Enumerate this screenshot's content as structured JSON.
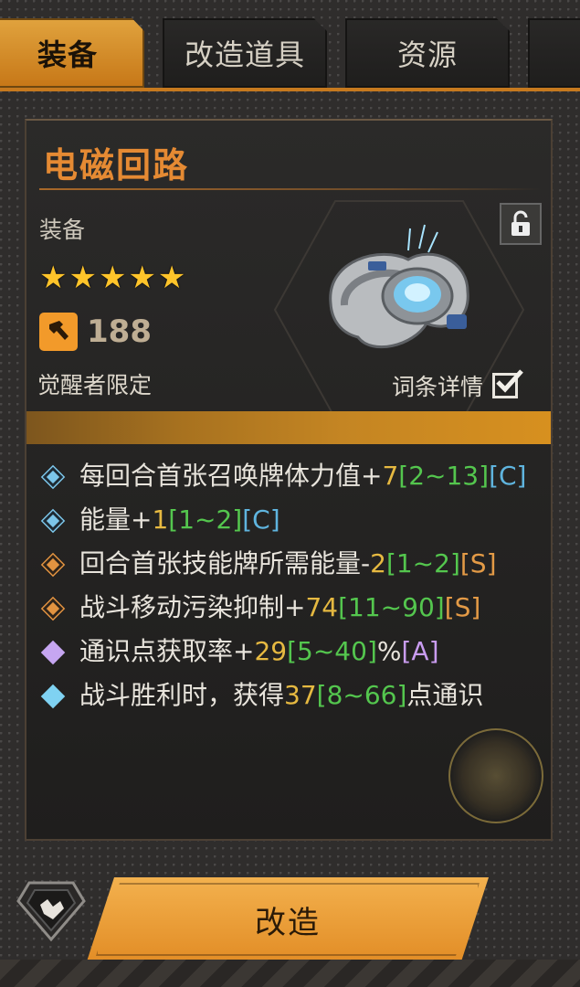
{
  "tabs": [
    {
      "label": "装备",
      "active": true
    },
    {
      "label": "改造道具",
      "active": false
    },
    {
      "label": "资源",
      "active": false
    },
    {
      "label": "",
      "active": false
    }
  ],
  "item": {
    "name": "电磁回路",
    "category": "装备",
    "rarity_stars": 5,
    "stars": "★★★★★",
    "power": "188",
    "restriction": "觉醒者限定",
    "detail_label": "词条详情",
    "detail_checked": true
  },
  "stats": [
    {
      "text": "每回合首张召唤牌体力值+",
      "value": "7",
      "range": "[2~13]",
      "grade": "[C]",
      "grade_color": "#5fb4de",
      "icon": "blue-diamond-icon"
    },
    {
      "text": "能量+",
      "value": "1",
      "range": "[1~2]",
      "grade": "[C]",
      "grade_color": "#5fb4de",
      "icon": "blue-diamond-icon"
    },
    {
      "text": "回合首张技能牌所需能量-",
      "value": "2",
      "range": "[1~2]",
      "grade": "[S]",
      "grade_color": "#e39a46",
      "icon": "orange-diamond-icon"
    },
    {
      "text": "战斗移动污染抑制+",
      "value": "74",
      "range": "[11~90]",
      "grade": "[S]",
      "grade_color": "#e39a46",
      "icon": "locked-orange-diamond-icon"
    },
    {
      "text": "通识点获取率+",
      "value": "29",
      "range": "[5~40]",
      "suffix": "%",
      "grade": "[A]",
      "grade_color": "#c99cf0",
      "icon": "purple-diamond-icon"
    },
    {
      "text": "战斗胜利时，获得",
      "value": "37",
      "range": "[8~66]",
      "suffix": "点通识",
      "grade": "",
      "grade_color": "",
      "icon": "cyan-diamond-icon"
    }
  ],
  "buttons": {
    "modify": "改造"
  },
  "colors": {
    "accent": "#e58a33",
    "value": "#e6b941",
    "range": "#54c64e"
  }
}
